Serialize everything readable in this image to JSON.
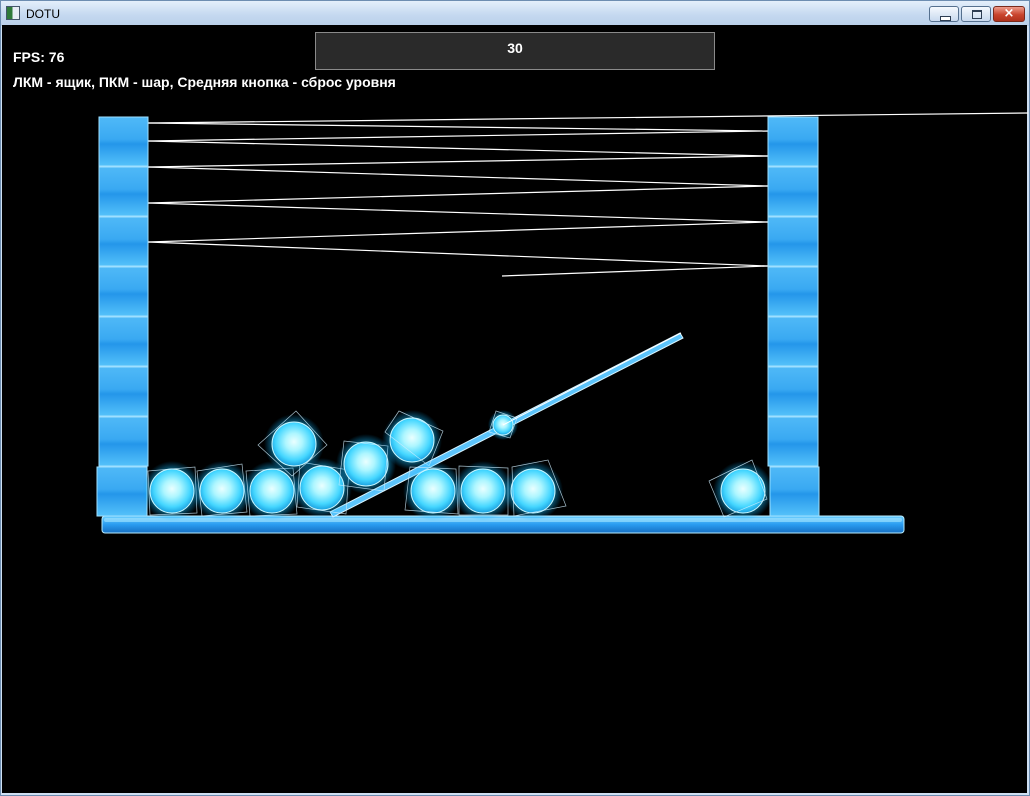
{
  "window": {
    "title": "DOTU",
    "minimize_label": "",
    "maximize_label": "",
    "close_glyph": "×"
  },
  "hud": {
    "fps_label": "FPS: ",
    "fps_value": "76",
    "help_text": "ЛКМ - ящик, ПКМ - шар, Средняя кнопка - сброс уровня",
    "counter_value": "30"
  },
  "colors": {
    "background": "#000000",
    "box_light": "#5cc4fb",
    "box_dark": "#1f8fe8",
    "ball_core": "#d8fdff",
    "ball_glow": "#34d9ff",
    "line": "#ffffff"
  },
  "icons": [
    "app-icon",
    "minimize-icon",
    "maximize-icon",
    "close-icon"
  ]
}
